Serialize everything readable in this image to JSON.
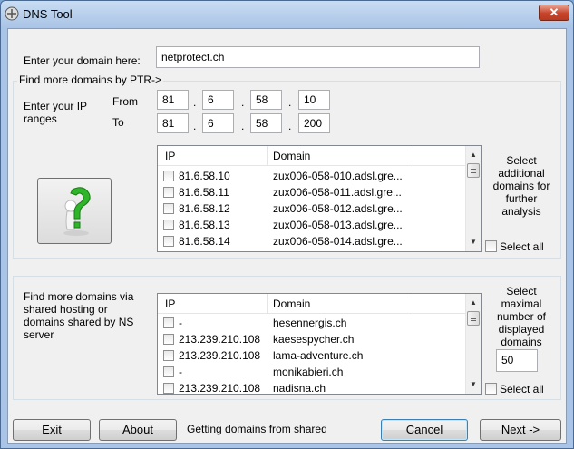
{
  "window": {
    "title": "DNS Tool",
    "close_glyph": "✕"
  },
  "domain": {
    "label": "Enter your domain here:",
    "value": "netprotect.ch"
  },
  "ptr": {
    "group_title": "Find more domains by PTR->",
    "range_label": "Enter your IP ranges",
    "from_label": "From",
    "to_label": "To",
    "from": [
      "81",
      "6",
      "58",
      "10"
    ],
    "to": [
      "81",
      "6",
      "58",
      "200"
    ],
    "dot": ".",
    "columns": {
      "ip": "IP",
      "domain": "Domain"
    },
    "rows": [
      {
        "ip": "81.6.58.10",
        "domain": "zux006-058-010.adsl.gre..."
      },
      {
        "ip": "81.6.58.11",
        "domain": "zux006-058-011.adsl.gre..."
      },
      {
        "ip": "81.6.58.12",
        "domain": "zux006-058-012.adsl.gre..."
      },
      {
        "ip": "81.6.58.13",
        "domain": "zux006-058-013.adsl.gre..."
      },
      {
        "ip": "81.6.58.14",
        "domain": "zux006-058-014.adsl.gre..."
      }
    ],
    "side_label": "Select additional domains for further analysis",
    "select_all": "Select all",
    "help_icon": "question-man-icon"
  },
  "shared": {
    "label": "Find more domains via shared hosting or domains shared by NS server",
    "columns": {
      "ip": "IP",
      "domain": "Domain"
    },
    "rows": [
      {
        "ip": "-",
        "domain": "hesennergis.ch"
      },
      {
        "ip": "213.239.210.108",
        "domain": "kaesespycher.ch"
      },
      {
        "ip": "213.239.210.108",
        "domain": "lama-adventure.ch"
      },
      {
        "ip": "-",
        "domain": "monikabieri.ch"
      },
      {
        "ip": "213.239.210.108",
        "domain": "nadisna.ch"
      }
    ],
    "max_label": "Select maximal number of displayed domains",
    "max_value": "50",
    "select_all": "Select all"
  },
  "footer": {
    "exit": "Exit",
    "about": "About",
    "status": "Getting domains from shared",
    "cancel": "Cancel",
    "next": "Next ->"
  }
}
